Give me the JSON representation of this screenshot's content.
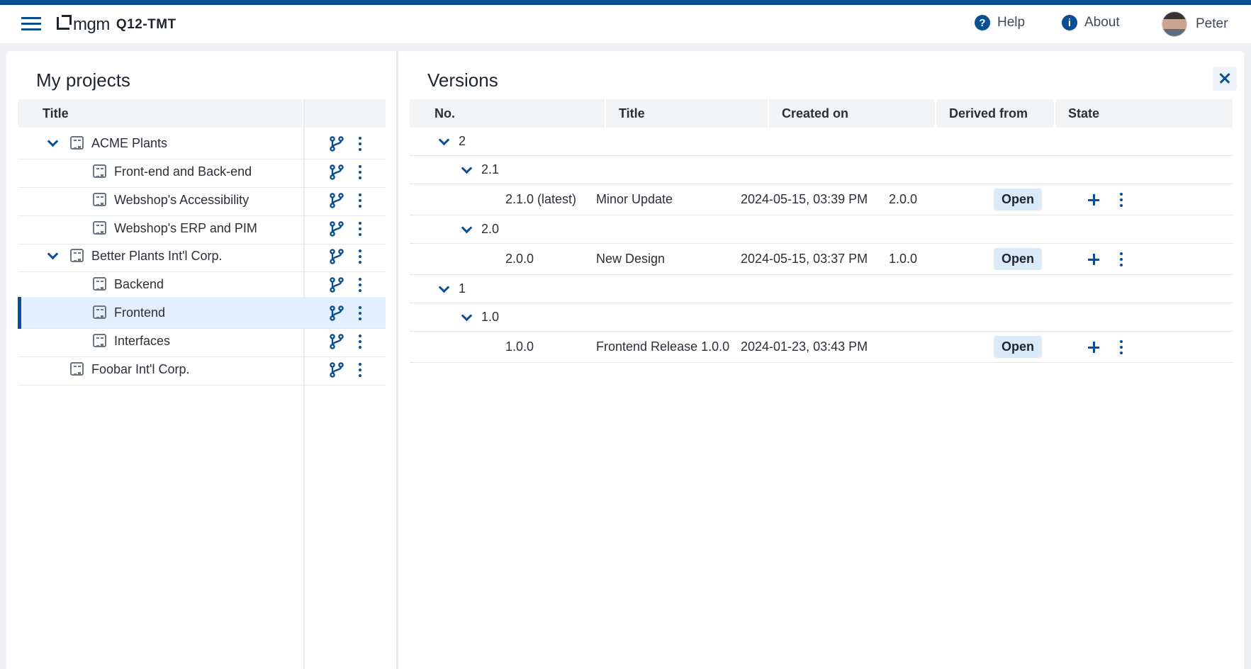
{
  "header": {
    "brand": "mgm",
    "product": "Q12-TMT",
    "help_label": "Help",
    "about_label": "About",
    "user_name": "Peter"
  },
  "projects": {
    "title": "My projects",
    "column_title": "Title",
    "rows": [
      {
        "label": "ACME Plants",
        "level": 0,
        "expanded": true
      },
      {
        "label": "Front-end and Back-end",
        "level": 1
      },
      {
        "label": "Webshop's Accessibility",
        "level": 1
      },
      {
        "label": "Webshop's ERP and PIM",
        "level": 1
      },
      {
        "label": "Better Plants Int'l Corp.",
        "level": 0,
        "expanded": true
      },
      {
        "label": "Backend",
        "level": 1
      },
      {
        "label": "Frontend",
        "level": 1,
        "selected": true
      },
      {
        "label": "Interfaces",
        "level": 1
      },
      {
        "label": "Foobar Int'l Corp.",
        "level": 0
      }
    ]
  },
  "versions": {
    "title": "Versions",
    "columns": {
      "no": "No.",
      "title": "Title",
      "created_on": "Created on",
      "derived_from": "Derived from",
      "state": "State"
    },
    "rows": [
      {
        "no": "2",
        "level": 0,
        "group": true
      },
      {
        "no": "2.1",
        "level": 1,
        "group": true
      },
      {
        "no": "2.1.0 (latest)",
        "level": 2,
        "title": "Minor Update",
        "created_on": "2024-05-15, 03:39 PM",
        "derived_from": "2.0.0",
        "state": "Open"
      },
      {
        "no": "2.0",
        "level": 1,
        "group": true
      },
      {
        "no": "2.0.0",
        "level": 2,
        "title": "New Design",
        "created_on": "2024-05-15, 03:37 PM",
        "derived_from": "1.0.0",
        "state": "Open"
      },
      {
        "no": "1",
        "level": 0,
        "group": true
      },
      {
        "no": "1.0",
        "level": 1,
        "group": true
      },
      {
        "no": "1.0.0",
        "level": 2,
        "title": "Frontend Release 1.0.0",
        "created_on": "2024-01-23, 03:43 PM",
        "derived_from": "",
        "state": "Open"
      }
    ]
  },
  "colors": {
    "accent": "#0b4f93",
    "selected_row": "#e3effc",
    "badge_bg": "#dbe9f7"
  },
  "icons": {
    "menu": "hamburger-menu-icon",
    "help": "help-circle-icon",
    "about": "info-circle-icon",
    "expand": "chevron-down-icon",
    "project": "project-document-icon",
    "branch": "branch-icon",
    "more": "kebab-menu-icon",
    "add": "plus-icon",
    "close": "close-icon"
  }
}
